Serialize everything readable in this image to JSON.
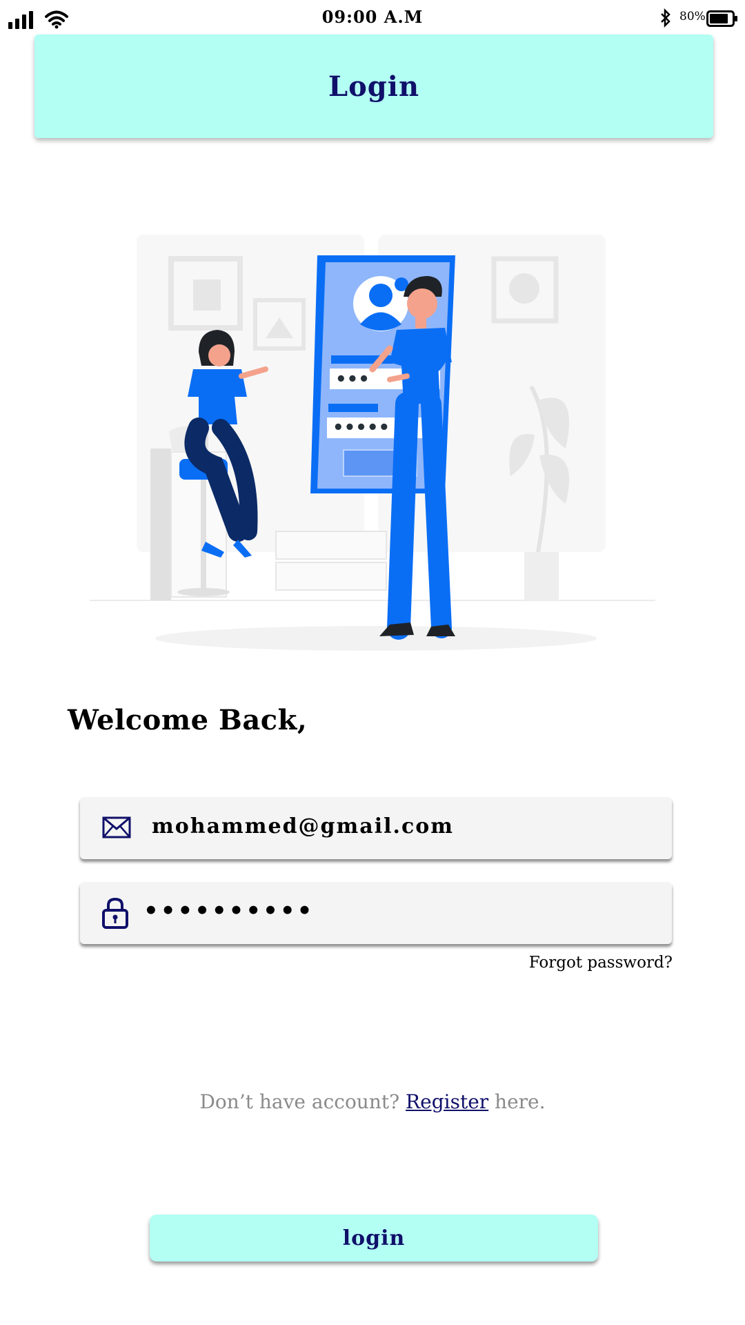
{
  "status_bar": {
    "time": "09:00 A.M",
    "battery": "80%",
    "icons": [
      "signal-icon",
      "wifi-icon",
      "bluetooth-icon",
      "battery-icon"
    ]
  },
  "header": {
    "title": "Login"
  },
  "illustration": {
    "description_icon": "login-illustration",
    "masked_password": "•••",
    "masked_pin": "•••••"
  },
  "welcome": "Welcome Back,",
  "email_field": {
    "value": "mohammed@gmail.com",
    "icon": "mail-icon"
  },
  "password_field": {
    "value": "••••••••••",
    "icon": "lock-icon"
  },
  "forgot_password": "Forgot password?",
  "register": {
    "prefix": "Don’t have account? ",
    "link": "Register",
    "suffix": " here."
  },
  "login_button": "login",
  "colors": {
    "accent": "#b3fff4",
    "navy": "#10106a",
    "illustration_blue": "#0a6ef5"
  }
}
